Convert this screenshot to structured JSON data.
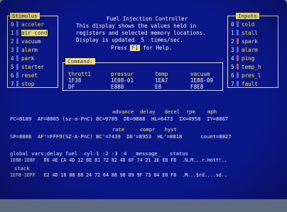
{
  "window": {
    "title": "Fuel Injection Controller",
    "intro": [
      "This display shows the values held in",
      "registers and selected memory locations.",
      "Display is updated  5  times/sec."
    ],
    "help_pre": "Press",
    "help_key": "F1",
    "help_post": "for Help."
  },
  "stimulus": {
    "title": "Stimulus",
    "items": [
      {
        "num": "0",
        "label": "acceler"
      },
      {
        "num": "1",
        "label": "air cond"
      },
      {
        "num": "2",
        "label": "vacuum"
      },
      {
        "num": "3",
        "label": "alarm"
      },
      {
        "num": "4",
        "label": "park"
      },
      {
        "num": "5",
        "label": "starter"
      },
      {
        "num": "6",
        "label": "reset"
      },
      {
        "num": "7",
        "label": "stop"
      }
    ]
  },
  "inputs": {
    "title": "Inputs",
    "items": [
      {
        "num": "0",
        "label": "cold"
      },
      {
        "num": "1",
        "label": "stall"
      },
      {
        "num": "2",
        "label": "spark"
      },
      {
        "num": "3",
        "label": "alarm"
      },
      {
        "num": "4",
        "label": "ping"
      },
      {
        "num": "5",
        "label": "temp_h"
      },
      {
        "num": "6",
        "label": "pres_l"
      },
      {
        "num": "7",
        "label": "fault"
      }
    ]
  },
  "command": {
    "title": "Command:",
    "headers": [
      "thrott1",
      "pressur",
      "temp",
      "vacuum"
    ],
    "row1": [
      "1F38",
      "1E08-01",
      "1EA7",
      "1E88-09"
    ],
    "row2": [
      "DF",
      "E888",
      "E8",
      "F8E8"
    ]
  },
  "registers": {
    "labels1": "advance  delay   decel  rpm    mph",
    "line1": "PC=8189  AF=8005 (sz-a-PnC) BC=9789  DE=9888  HL=6473  IX=4958  IY=8867",
    "labels2": "rate     compr   hyst",
    "line2": "SP=8888  AF'=FFF9(SZ-A-PnC) BC'=7439  DE'=8953  HL'=8818      count=8827"
  },
  "memory": {
    "header": "global vars:delay fuel  cyl:1 :2 :3 :4  _message_   status",
    "line1": "1E88-1E8F   06 4E CA 4D 12 8E 81 72 82 48 6F 74 21 2E E8 F8  .N.M...r.Hott!..",
    "stack_label": "stack",
    "line2": "1EF8-1EFF   E2 4D 18 88 88 24 72 64 88 98 89 9F 73 64 E8 F8  .M...$rd....sd.."
  }
}
